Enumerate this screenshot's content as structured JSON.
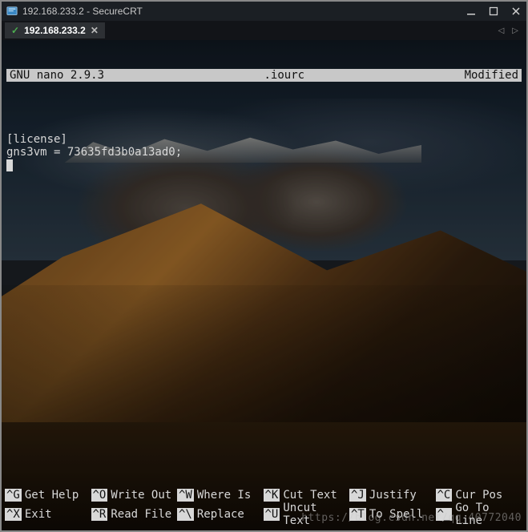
{
  "window": {
    "title": "192.168.233.2 - SecureCRT"
  },
  "tab": {
    "label": "192.168.233.2",
    "connected_indicator": "✓",
    "close_glyph": "✕",
    "nav_left": "◁",
    "nav_right": "▷"
  },
  "nano": {
    "header_left": "GNU nano 2.9.3",
    "header_center": ".iourc",
    "header_right": "Modified",
    "line1": "[license]",
    "line2": "gns3vm = 73635fd3b0a13ad0;"
  },
  "shortcuts": {
    "row1": [
      {
        "key": "^G",
        "label": "Get Help"
      },
      {
        "key": "^O",
        "label": "Write Out"
      },
      {
        "key": "^W",
        "label": "Where Is"
      },
      {
        "key": "^K",
        "label": "Cut Text"
      },
      {
        "key": "^J",
        "label": "Justify"
      },
      {
        "key": "^C",
        "label": "Cur Pos"
      }
    ],
    "row2": [
      {
        "key": "^X",
        "label": "Exit"
      },
      {
        "key": "^R",
        "label": "Read File"
      },
      {
        "key": "^\\",
        "label": "Replace"
      },
      {
        "key": "^U",
        "label": "Uncut Text"
      },
      {
        "key": "^T",
        "label": "To Spell"
      },
      {
        "key": "^_",
        "label": "Go To Line"
      }
    ]
  },
  "watermark": "https://blog.csdn.net/qq_40772040"
}
